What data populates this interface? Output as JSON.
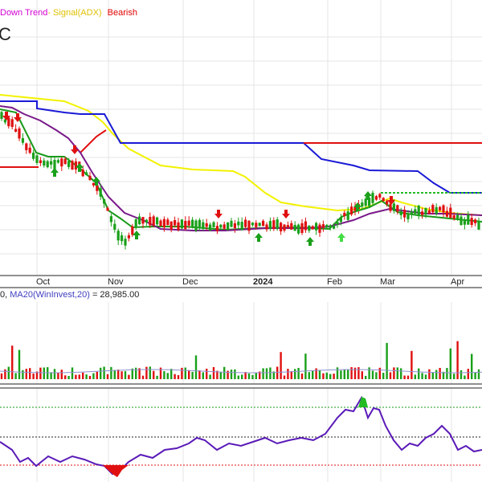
{
  "legend": {
    "trend": "Down Trend",
    "signal": "Signal(ADX)",
    "status": "Bearish"
  },
  "ticker_fragment": "C",
  "volume_legend": {
    "prefix": "0, ",
    "ma_label": "MA20(WinInvest,20)",
    "value_text": " = 28,985.00"
  },
  "colors": {
    "upper_band": "#1a1ad6",
    "lower_band": "#e01010",
    "cloud_line": "#f2f200",
    "ema_green": "#1a9a1a",
    "ma_purple": "#7a1a8a",
    "bull_bar": "#1aa01a",
    "bear_bar": "#e01010",
    "oscillator": "#5a1ab8",
    "grid": "#e4e4e4",
    "ref_green": "#1a9a1a",
    "ref_red": "#e01010"
  },
  "chart_data": {
    "type": "line",
    "x_axis": {
      "tick_labels": [
        "Oct",
        "Nov",
        "Dec",
        "2024",
        "Feb",
        "Mar",
        "Apr"
      ],
      "bold_labels": [
        "2024"
      ]
    },
    "price_panel": {
      "series_shown": [
        "candles",
        "ema",
        "ma",
        "upper band",
        "lower band",
        "signal line"
      ],
      "signal_markers": {
        "buy": 9,
        "sell": 6
      }
    },
    "volume_panel": {
      "ma_name": "MA20(WinInvest,20)",
      "ma_value": 28985.0
    },
    "oscillator_panel": {
      "upper_ref": "green dotted",
      "mid_ref": "black dotted",
      "lower_ref": "red dotted"
    }
  }
}
